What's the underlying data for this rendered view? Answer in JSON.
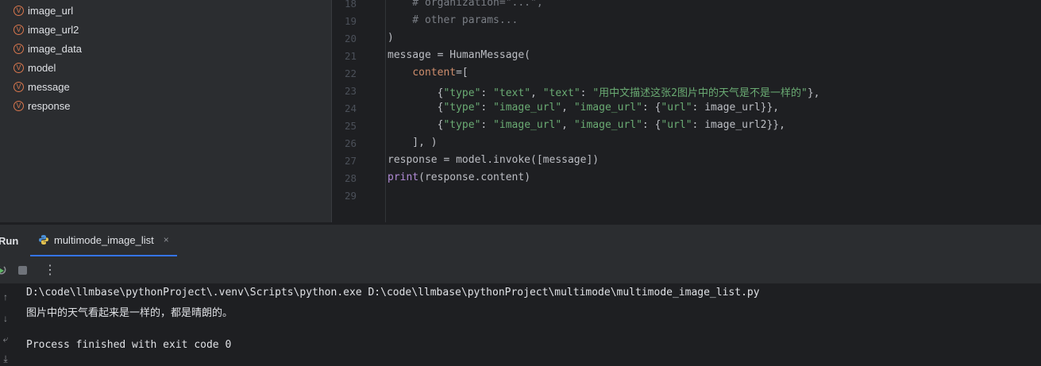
{
  "structure": {
    "items": [
      {
        "label": "image_url"
      },
      {
        "label": "image_url2"
      },
      {
        "label": "image_data"
      },
      {
        "label": "model"
      },
      {
        "label": "message"
      },
      {
        "label": "response"
      }
    ],
    "badge": "V"
  },
  "editor": {
    "line_numbers": [
      "18",
      "19",
      "20",
      "21",
      "22",
      "23",
      "24",
      "25",
      "26",
      "27",
      "28",
      "29"
    ],
    "lines": {
      "l18": "    # organization=\"...\",",
      "l19": "    # other params...",
      "l20": ")",
      "l21": "message = HumanMessage(",
      "l22a": "    ",
      "l22b": "content",
      "l22c": "=[",
      "l23a": "        {",
      "l23b": "\"type\"",
      "l23c": ": ",
      "l23d": "\"text\"",
      "l23e": ", ",
      "l23f": "\"text\"",
      "l23g": ": ",
      "l23h": "\"用中文描述这张2图片中的天气是不是一样的\"",
      "l23i": "},",
      "l24a": "        {",
      "l24b": "\"type\"",
      "l24c": ": ",
      "l24d": "\"image_url\"",
      "l24e": ", ",
      "l24f": "\"image_url\"",
      "l24g": ": {",
      "l24h": "\"url\"",
      "l24i": ": image_url}},",
      "l25a": "        {",
      "l25b": "\"type\"",
      "l25c": ": ",
      "l25d": "\"image_url\"",
      "l25e": ", ",
      "l25f": "\"image_url\"",
      "l25g": ": {",
      "l25h": "\"url\"",
      "l25i": ": image_url2}},",
      "l26": "    ], )",
      "l27": "response = model.invoke([message])",
      "l28a": "print",
      "l28b": "(response.content)"
    }
  },
  "run": {
    "title": "Run",
    "tab_label": "multimode_image_list",
    "close_glyph": "×",
    "more_glyph": "⋮"
  },
  "console": {
    "lines": [
      "D:\\code\\llmbase\\pythonProject\\.venv\\Scripts\\python.exe D:\\code\\llmbase\\pythonProject\\multimode\\multimode_image_list.py",
      "图片中的天气看起来是一样的，都是晴朗的。",
      "",
      "Process finished with exit code 0"
    ]
  }
}
